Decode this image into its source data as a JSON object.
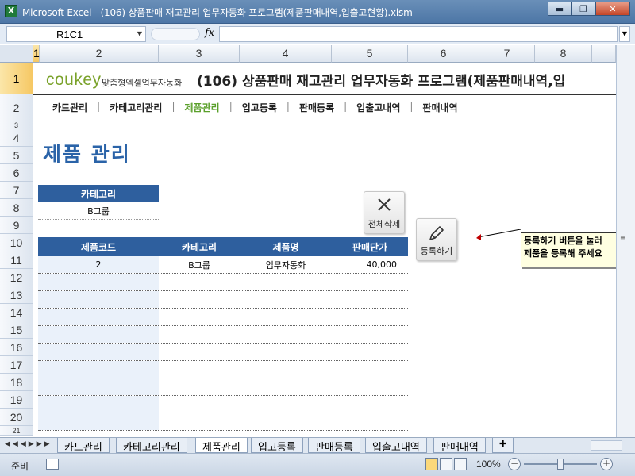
{
  "window": {
    "app_icon": "X",
    "title": "Microsoft Excel - (106) 상품판매 재고관리 업무자동화 프로그램(제품판매내역,입출고현황).xlsm",
    "minimize": "▬",
    "maximize": "❐",
    "close": "✕"
  },
  "formula_bar": {
    "name_box": "R1C1",
    "fx_label": "fx",
    "formula": ""
  },
  "columns": [
    "1",
    "2",
    "3",
    "4",
    "5",
    "6",
    "7",
    "8"
  ],
  "rows": [
    "1",
    "2",
    "3",
    "4",
    "5",
    "6",
    "7",
    "8",
    "9",
    "10",
    "11",
    "12",
    "13",
    "14",
    "15",
    "16",
    "17",
    "18",
    "19",
    "20",
    "21"
  ],
  "header": {
    "brand": "coukey",
    "brand_sub": "맞춤형엑셀업무자동화",
    "title": "(106) 상품판매 재고관리 업무자동화 프로그램(제품판매내역,입"
  },
  "nav": [
    "카드관리",
    "카테고리관리",
    "제품관리",
    "입고등록",
    "판매등록",
    "입출고내역",
    "판매내역"
  ],
  "nav_separator": "|",
  "page_title": "제품 관리",
  "category_filter": {
    "label": "카테고리",
    "value": "B그룹"
  },
  "buttons": {
    "delete_all": "전체삭제",
    "register": "등록하기"
  },
  "table": {
    "headers": [
      "제품코드",
      "카테고리",
      "제품명",
      "판매단가"
    ],
    "rows": [
      [
        "2",
        "B그룹",
        "업무자동화",
        "40,000"
      ],
      [
        "",
        "",
        "",
        ""
      ],
      [
        "",
        "",
        "",
        ""
      ],
      [
        "",
        "",
        "",
        ""
      ],
      [
        "",
        "",
        "",
        ""
      ],
      [
        "",
        "",
        "",
        ""
      ],
      [
        "",
        "",
        "",
        ""
      ],
      [
        "",
        "",
        "",
        ""
      ],
      [
        "",
        "",
        "",
        ""
      ],
      [
        "",
        "",
        "",
        ""
      ]
    ]
  },
  "note": {
    "line1": "등록하기 버튼을 눌러",
    "line2": "제품을 등록해 주세요"
  },
  "sheet_tabs": [
    "카드관리",
    "카테고리관리",
    "제품관리",
    "입고등록",
    "판매등록",
    "입출고내역",
    "판매내역"
  ],
  "active_tab": "제품관리",
  "status": {
    "ready": "준비",
    "zoom": "100%"
  },
  "colors": {
    "accent": "#2e5f9e",
    "brand": "#7aa22a",
    "active_nav": "#5aa02a",
    "page_title": "#2a63a8"
  }
}
